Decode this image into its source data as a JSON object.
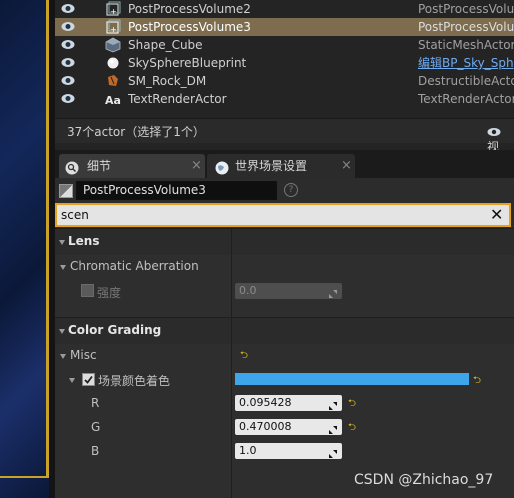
{
  "outliner": {
    "rows": [
      {
        "name": "PostProcessVolume2",
        "type": "PostProcessVolu",
        "icon": "post-process-volume-icon",
        "selected": false,
        "link": false
      },
      {
        "name": "PostProcessVolume3",
        "type": "PostProcessVolu",
        "icon": "post-process-volume-icon",
        "selected": true,
        "link": false
      },
      {
        "name": "Shape_Cube",
        "type": "StaticMeshActor",
        "icon": "static-mesh-icon",
        "selected": false,
        "link": false
      },
      {
        "name": "SkySphereBlueprint",
        "type": "编辑BP_Sky_Sph",
        "icon": "sphere-icon",
        "selected": false,
        "link": true
      },
      {
        "name": "SM_Rock_DM",
        "type": "DestructibleActor",
        "icon": "destructible-icon",
        "selected": false,
        "link": false
      },
      {
        "name": "TextRenderActor",
        "type": "TextRenderActor",
        "icon": "text-render-icon",
        "selected": false,
        "link": false
      }
    ],
    "footer": {
      "count_text": "37个actor（选择了1个）",
      "view_options_label": "视"
    }
  },
  "tabs": [
    {
      "label": "细节",
      "icon": "search-icon"
    },
    {
      "label": "世界场景设置",
      "icon": "globe-icon"
    }
  ],
  "details": {
    "object_name": "PostProcessVolume3",
    "search_value": "scen",
    "sections": {
      "lens": "Lens",
      "chromatic_aberration": "Chromatic Aberration",
      "intensity_label": "强度",
      "intensity_value": "0.0",
      "color_grading": "Color Grading",
      "misc": "Misc",
      "scene_color_tint": "场景颜色着色",
      "tint_color": "#3fa5ea",
      "r_label": "R",
      "r_value": "0.095428",
      "g_label": "G",
      "g_value": "0.470008",
      "b_label": "B",
      "b_value": "1.0"
    }
  },
  "watermark": "CSDN @Zhichao_97",
  "colors": {
    "selection": "#7d6c4d",
    "search_border": "#e5a21e",
    "reset_arrow": "#e0c020",
    "viewport_frame": "#c9a227"
  }
}
